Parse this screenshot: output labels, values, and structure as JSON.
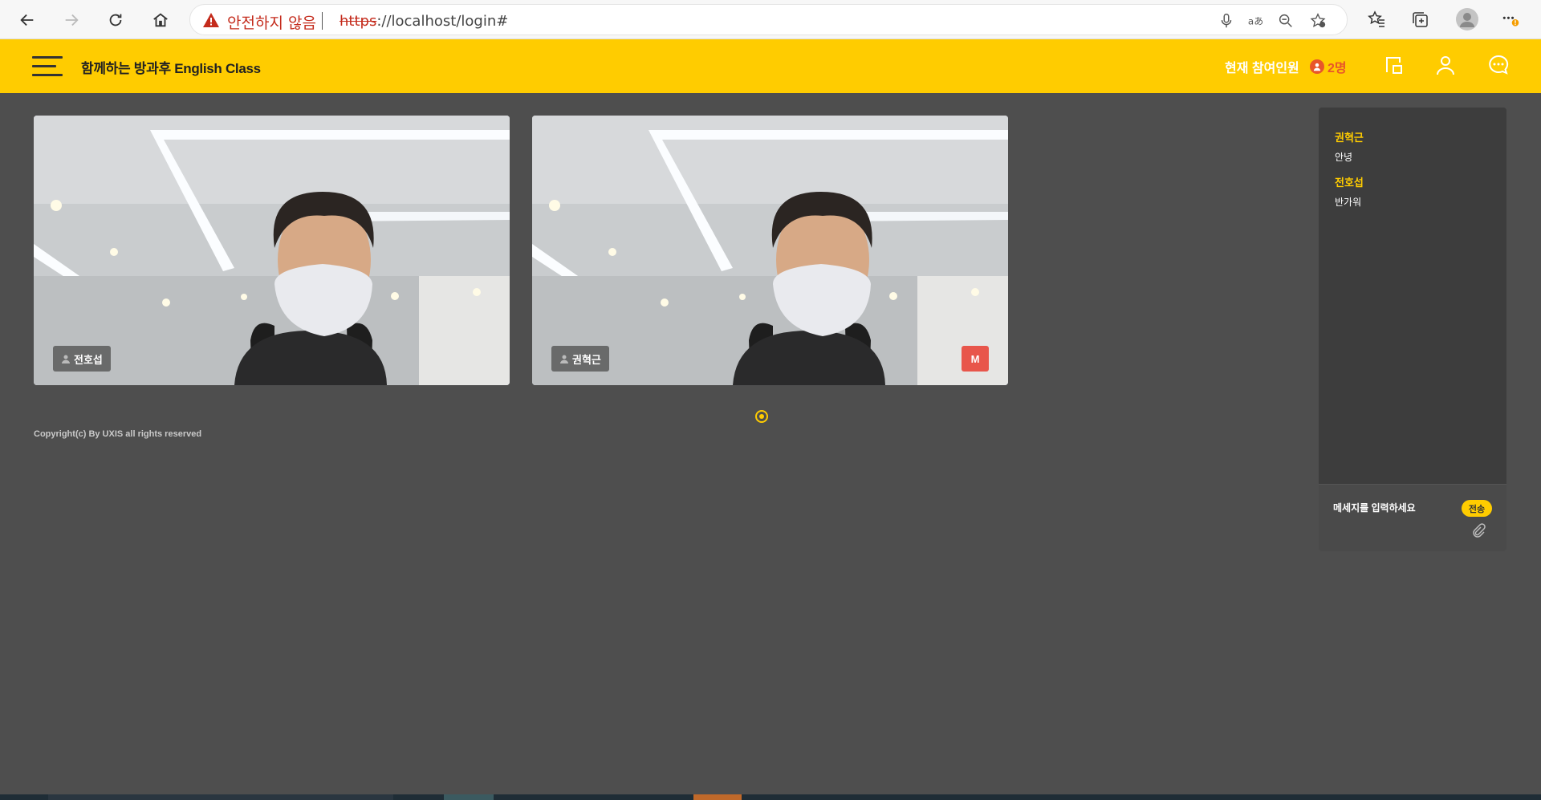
{
  "browser": {
    "security_label": "안전하지 않음",
    "url_scheme": "https",
    "url_rest": "://localhost/login#"
  },
  "header": {
    "title": "함께하는 방과후 English Class",
    "participants_label": "현재 참여인원",
    "participants_count": "2명"
  },
  "videos": [
    {
      "name": "전호섭",
      "moderator": false
    },
    {
      "name": "권혁근",
      "moderator": true,
      "moderator_badge": "M"
    }
  ],
  "footer": {
    "copyright": "Copyright(c) By UXIS all rights reserved"
  },
  "chat": {
    "messages": [
      {
        "sender": "권혁근",
        "text": "안녕"
      },
      {
        "sender": "전호섭",
        "text": "반가워"
      }
    ],
    "input_placeholder": "메세지를 입력하세요",
    "send_label": "전송"
  },
  "colors": {
    "accent": "#ffcc00",
    "background": "#4e4e4e",
    "panel": "#3d3d3d",
    "alert": "#e8564b"
  }
}
